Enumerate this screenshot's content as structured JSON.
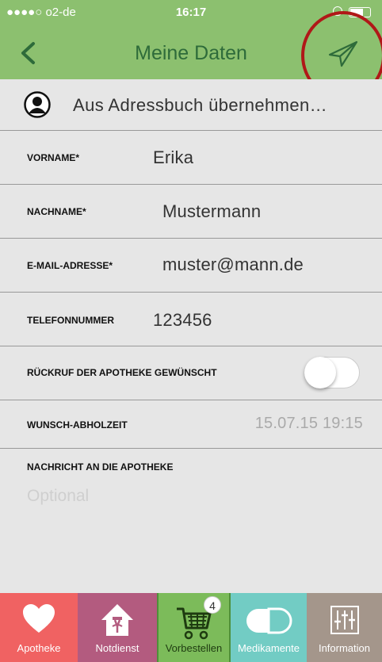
{
  "status_bar": {
    "carrier": "●●●●○ o2-de",
    "time": "16:17"
  },
  "navbar": {
    "title": "Meine Daten"
  },
  "address_book": {
    "label": "Aus Adressbuch übernehmen…"
  },
  "fields": {
    "vorname": {
      "label": "VORNAME*",
      "value": "Erika"
    },
    "nachname": {
      "label": "NACHNAME*",
      "value": "Mustermann"
    },
    "email": {
      "label": "E-MAIL-ADRESSE*",
      "value": "muster@mann.de"
    },
    "telefon": {
      "label": "TELEFONNUMMER",
      "value": "123456"
    },
    "rueckruf": {
      "label": "RÜCKRUF DER APOTHEKE GEWÜNSCHT",
      "enabled": false
    },
    "abholzeit": {
      "label": "WUNSCH-ABHOLZEIT",
      "value": "15.07.15 19:15"
    }
  },
  "message": {
    "label": "NACHRICHT AN DIE APOTHEKE",
    "placeholder": "Optional"
  },
  "tabs": [
    {
      "label": "Apotheke",
      "icon": "heart-icon",
      "color": "#f06262"
    },
    {
      "label": "Notdienst",
      "icon": "pharmacy-house-icon",
      "color": "#b35b7f"
    },
    {
      "label": "Vorbestellen",
      "icon": "cart-icon",
      "color": "#7cbb5a",
      "badge": "4"
    },
    {
      "label": "Medikamente",
      "icon": "pill-icon",
      "color": "#72ccc4"
    },
    {
      "label": "Information",
      "icon": "sliders-icon",
      "color": "#a4968b"
    }
  ],
  "colors": {
    "header_green": "#8cc06f",
    "title_green": "#2e6b3a",
    "highlight_red": "#b01818"
  }
}
